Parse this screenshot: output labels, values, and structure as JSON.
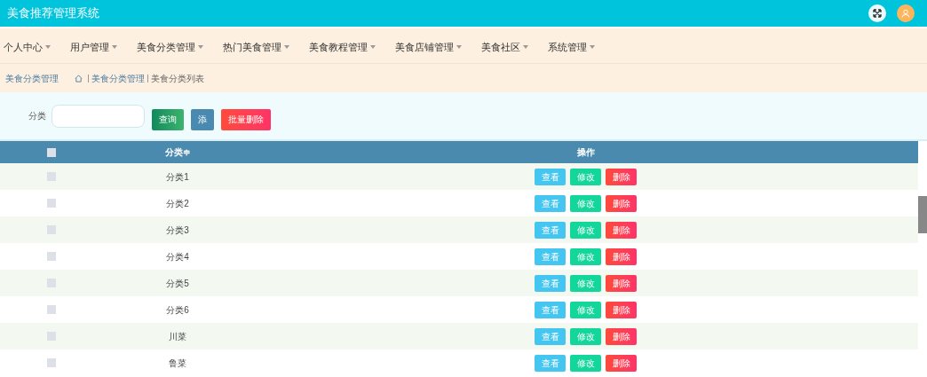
{
  "header": {
    "title": "美食推荐管理系统"
  },
  "nav": [
    {
      "label": "个人中心"
    },
    {
      "label": "用户管理"
    },
    {
      "label": "美食分类管理"
    },
    {
      "label": "热门美食管理"
    },
    {
      "label": "美食教程管理"
    },
    {
      "label": "美食店铺管理"
    },
    {
      "label": "美食社区"
    },
    {
      "label": "系统管理"
    }
  ],
  "breadcrumb": {
    "title": "美食分类管理",
    "path": [
      "美食分类管理",
      "美食分类列表"
    ]
  },
  "search": {
    "label": "分类",
    "buttons": [
      {
        "label": "查询",
        "kind": "search"
      },
      {
        "label": "添",
        "kind": "add"
      },
      {
        "label": "批量删除",
        "kind": "delete"
      }
    ]
  },
  "table": {
    "columns": [
      "分类",
      "操作"
    ],
    "sort_mark": "≑",
    "select_all": {
      "checked": false
    },
    "rows": [
      {
        "name": "分类1",
        "checked": false,
        "actions": [
          {
            "label": "查看",
            "kind": "view"
          },
          {
            "label": "修改",
            "kind": "edit"
          },
          {
            "label": "删除",
            "kind": "delete"
          }
        ]
      },
      {
        "name": "分类2",
        "checked": false,
        "actions": [
          {
            "label": "查看",
            "kind": "view"
          },
          {
            "label": "修改",
            "kind": "edit"
          },
          {
            "label": "删除",
            "kind": "delete"
          }
        ]
      },
      {
        "name": "分类3",
        "checked": false,
        "actions": [
          {
            "label": "查看",
            "kind": "view"
          },
          {
            "label": "修改",
            "kind": "edit"
          },
          {
            "label": "删除",
            "kind": "delete"
          }
        ]
      },
      {
        "name": "分类4",
        "checked": false,
        "actions": [
          {
            "label": "查看",
            "kind": "view"
          },
          {
            "label": "修改",
            "kind": "edit"
          },
          {
            "label": "删除",
            "kind": "delete"
          }
        ]
      },
      {
        "name": "分类5",
        "checked": false,
        "actions": [
          {
            "label": "查看",
            "kind": "view"
          },
          {
            "label": "修改",
            "kind": "edit"
          },
          {
            "label": "删除",
            "kind": "delete"
          }
        ]
      },
      {
        "name": "分类6",
        "checked": false,
        "actions": [
          {
            "label": "查看",
            "kind": "view"
          },
          {
            "label": "修改",
            "kind": "edit"
          },
          {
            "label": "删除",
            "kind": "delete"
          }
        ]
      },
      {
        "name": "川菜",
        "checked": false,
        "actions": [
          {
            "label": "查看",
            "kind": "view"
          },
          {
            "label": "修改",
            "kind": "edit"
          },
          {
            "label": "删除",
            "kind": "delete"
          }
        ]
      },
      {
        "name": "鲁菜",
        "checked": false,
        "actions": [
          {
            "label": "查看",
            "kind": "view"
          },
          {
            "label": "修改",
            "kind": "edit"
          },
          {
            "label": "删除",
            "kind": "delete"
          }
        ]
      }
    ]
  }
}
